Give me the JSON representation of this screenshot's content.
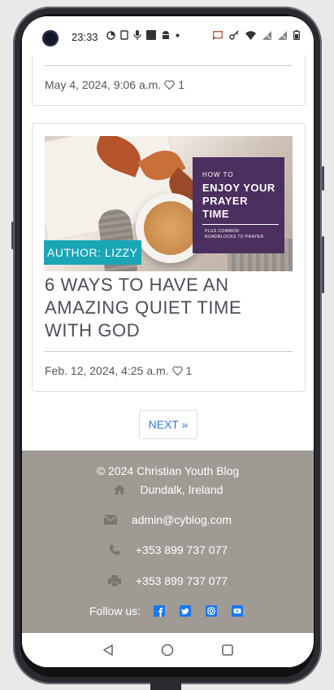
{
  "status_bar": {
    "time": "23:33"
  },
  "posts": [
    {
      "meta": "May 4, 2024, 9:06 a.m.",
      "likes": "1"
    },
    {
      "image_overlay": {
        "small": "HOW TO",
        "big_lines": [
          "ENJOY YOUR",
          "PRAYER",
          "TIME"
        ],
        "tiny_lines": [
          "PLUS COMMON",
          "ROADBLOCKS TO PRAYER"
        ]
      },
      "author_badge": "AUTHOR: LIZZY",
      "title": "6 WAYS TO HAVE AN AMAZING QUIET TIME WITH GOD",
      "meta": "Feb. 12, 2024, 4:25 a.m.",
      "likes": "1"
    }
  ],
  "pagination": {
    "next_label": "NEXT »"
  },
  "footer": {
    "copyright": "© 2024 Christian Youth Blog",
    "location": "Dundalk, Ireland",
    "email": "admin@cyblog.com",
    "phone": "+353 899 737 077",
    "fax": "+353 899 737 077",
    "follow_label": "Follow us:",
    "social_icons": [
      "facebook-icon",
      "twitter-icon",
      "instagram-icon",
      "youtube-icon"
    ]
  },
  "colors": {
    "accent": "#1aa6b7",
    "link": "#2a7ae2",
    "footer_bg": "#a09a94",
    "promo_bg": "#4b2f5e",
    "social": "#1877f2"
  }
}
